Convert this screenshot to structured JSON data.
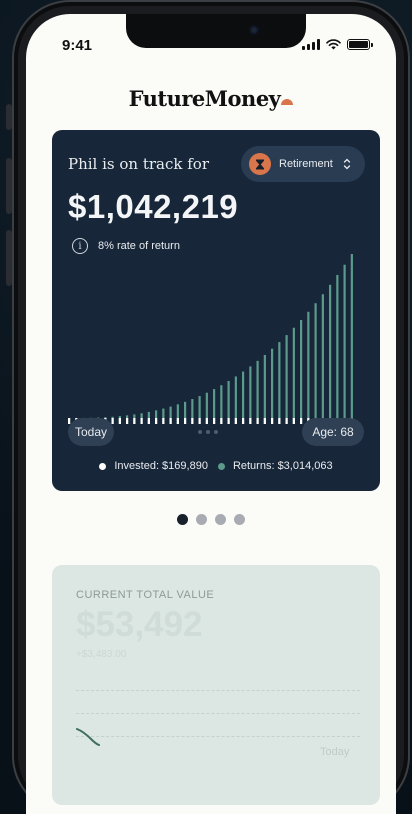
{
  "status": {
    "time": "9:41"
  },
  "brand": {
    "name": "FutureMoney"
  },
  "projection_card": {
    "headline": "Phil is on track for",
    "goal": {
      "label": "Retirement",
      "icon": "hourglass-icon"
    },
    "amount": "$1,042,219",
    "rate": "8% rate of return",
    "start_label": "Today",
    "end_label": "Age: 68",
    "legend": {
      "invested": "Invested: $169,890",
      "returns": "Returns: $3,014,063"
    },
    "colors": {
      "background": "#172639",
      "invested": "#ffffff",
      "returns": "#5c9a8c"
    }
  },
  "pager": {
    "count": 4,
    "active": 0
  },
  "value_card": {
    "title": "CURRENT TOTAL VALUE",
    "value": "$53,492",
    "change": "+$3,483.00",
    "end_label": "Today"
  }
}
